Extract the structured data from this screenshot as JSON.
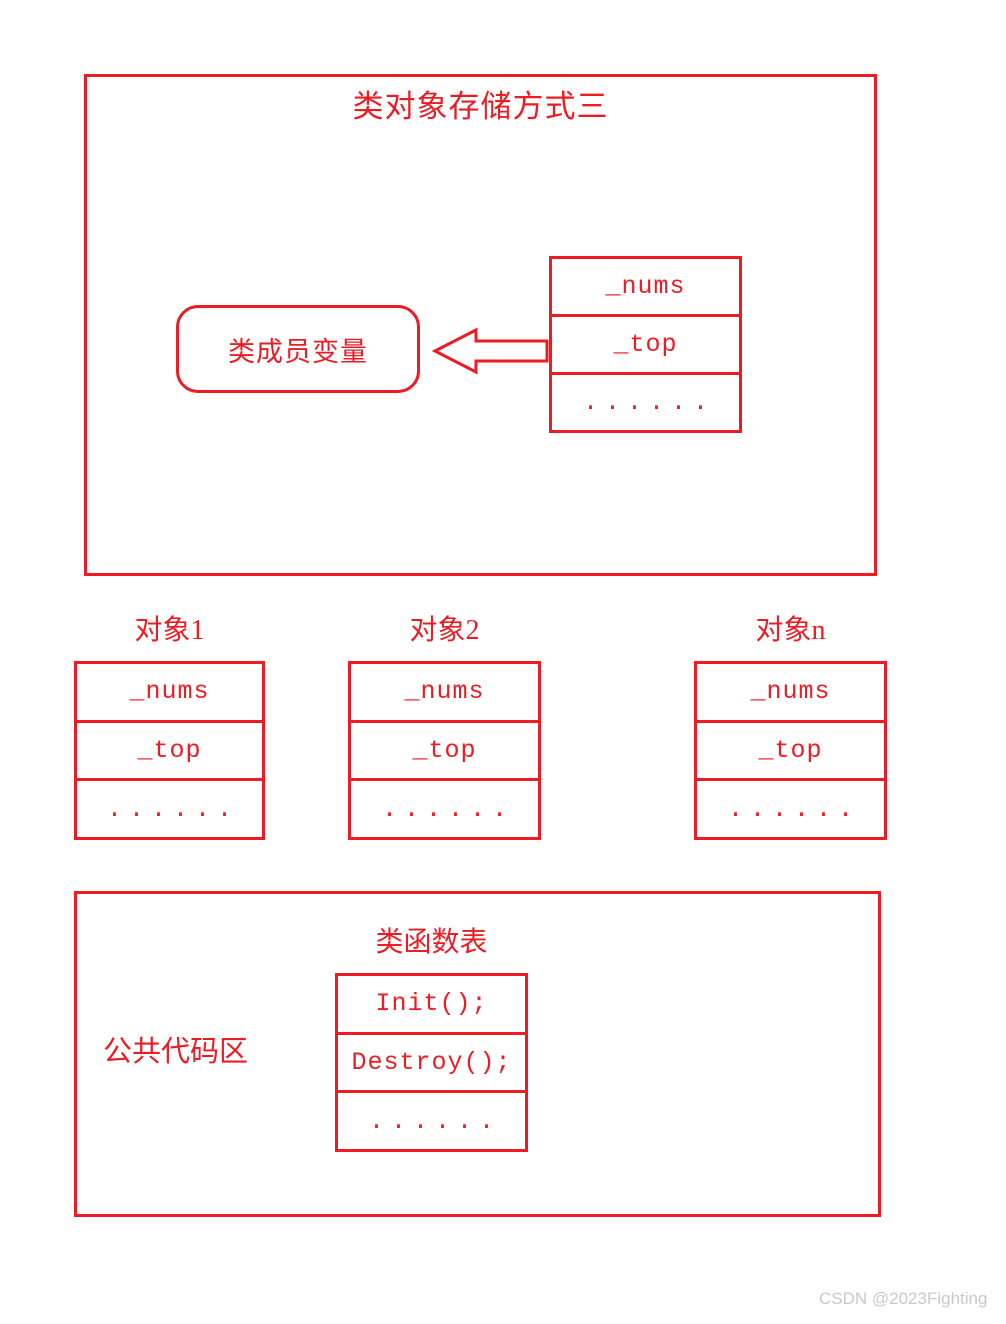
{
  "colors": {
    "stroke": "#ED1C24",
    "text": "#ED1C24",
    "background": "#FFFFFF",
    "watermark": "#C9C9C9"
  },
  "top_section": {
    "title": "类对象存储方式三",
    "pill_label": "类成员变量",
    "arrow_direction": "left",
    "member_table": {
      "rows": [
        "_nums",
        "_top",
        "......"
      ]
    }
  },
  "objects": [
    {
      "label": "对象1",
      "rows": [
        "_nums",
        "_top",
        "......"
      ]
    },
    {
      "label": "对象2",
      "rows": [
        "_nums",
        "_top",
        "......"
      ]
    },
    {
      "label": "对象n",
      "rows": [
        "_nums",
        "_top",
        "......"
      ]
    }
  ],
  "bottom_section": {
    "area_label": "公共代码区",
    "function_table_title": "类函数表",
    "function_table": {
      "rows": [
        "Init();",
        "Destroy();",
        "......"
      ]
    }
  },
  "watermark": "CSDN @2023Fighting"
}
